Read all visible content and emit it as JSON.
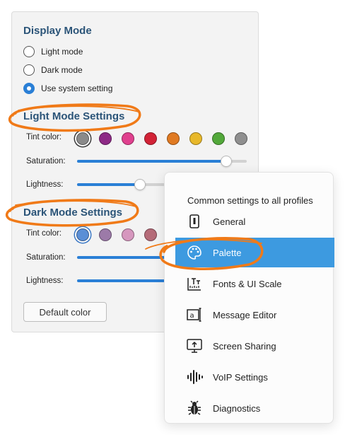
{
  "display_mode": {
    "heading": "Display Mode",
    "options": [
      {
        "label": "Light mode",
        "selected": false
      },
      {
        "label": "Dark mode",
        "selected": false
      },
      {
        "label": "Use system setting",
        "selected": true
      }
    ]
  },
  "light_mode": {
    "heading": "Light Mode Settings",
    "tint_label": "Tint color:",
    "saturation_label": "Saturation:",
    "lightness_label": "Lightness:",
    "swatches": [
      "#8a8a8a",
      "#8e2a86",
      "#e0408e",
      "#d22236",
      "#e07a22",
      "#e8b82a",
      "#52a83a",
      "#8f8f8f"
    ],
    "selected_swatch_index": 0,
    "saturation_value": 0.88,
    "lightness_value": 0.37
  },
  "dark_mode": {
    "heading": "Dark Mode Settings",
    "tint_label": "Tint color:",
    "saturation_label": "Saturation:",
    "lightness_label": "Lightness:",
    "swatches": [
      "#5b8fd6",
      "#9c7aa8",
      "#d697be",
      "#b56b78"
    ],
    "selected_swatch_index": 0
  },
  "default_color_button": "Default color",
  "menu": {
    "title": "Common settings to all profiles",
    "items": [
      {
        "label": "General",
        "icon": "general-icon",
        "active": false
      },
      {
        "label": "Palette",
        "icon": "palette-icon",
        "active": true
      },
      {
        "label": "Fonts & UI Scale",
        "icon": "fonts-scale-icon",
        "active": false
      },
      {
        "label": "Message Editor",
        "icon": "message-editor-icon",
        "active": false
      },
      {
        "label": "Screen Sharing",
        "icon": "screen-sharing-icon",
        "active": false
      },
      {
        "label": "VoIP Settings",
        "icon": "voip-icon",
        "active": false
      },
      {
        "label": "Diagnostics",
        "icon": "diagnostics-icon",
        "active": false
      }
    ]
  },
  "colors": {
    "accent": "#2a7fd6",
    "menu_highlight": "#3d9ae0",
    "heading": "#2b5478",
    "annotation": "#f07a18"
  }
}
